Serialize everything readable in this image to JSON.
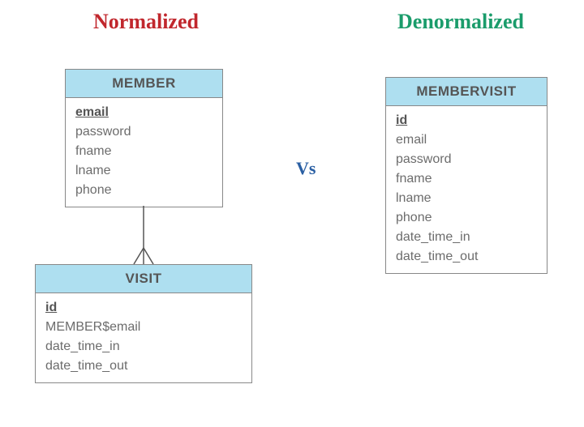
{
  "headers": {
    "normalized": "Normalized",
    "denormalized": "Denormalized",
    "vs": "Vs"
  },
  "colors": {
    "normalized": "#c1272d",
    "denormalized": "#1a9c6b",
    "vs": "#2a5fa3",
    "table_header_bg": "#aedff0"
  },
  "tables": {
    "member": {
      "title": "MEMBER",
      "fields": [
        {
          "name": "email",
          "pk": true
        },
        {
          "name": "password",
          "pk": false
        },
        {
          "name": "fname",
          "pk": false
        },
        {
          "name": "lname",
          "pk": false
        },
        {
          "name": "phone",
          "pk": false
        }
      ]
    },
    "visit": {
      "title": "VISIT",
      "fields": [
        {
          "name": "id",
          "pk": true
        },
        {
          "name": "MEMBER$email",
          "pk": false
        },
        {
          "name": "date_time_in",
          "pk": false
        },
        {
          "name": "date_time_out",
          "pk": false
        }
      ]
    },
    "membervisit": {
      "title": "MEMBERVISIT",
      "fields": [
        {
          "name": "id",
          "pk": true
        },
        {
          "name": "email",
          "pk": false
        },
        {
          "name": "password",
          "pk": false
        },
        {
          "name": "fname",
          "pk": false
        },
        {
          "name": "lname",
          "pk": false
        },
        {
          "name": "phone",
          "pk": false
        },
        {
          "name": "date_time_in",
          "pk": false
        },
        {
          "name": "date_time_out",
          "pk": false
        }
      ]
    }
  }
}
